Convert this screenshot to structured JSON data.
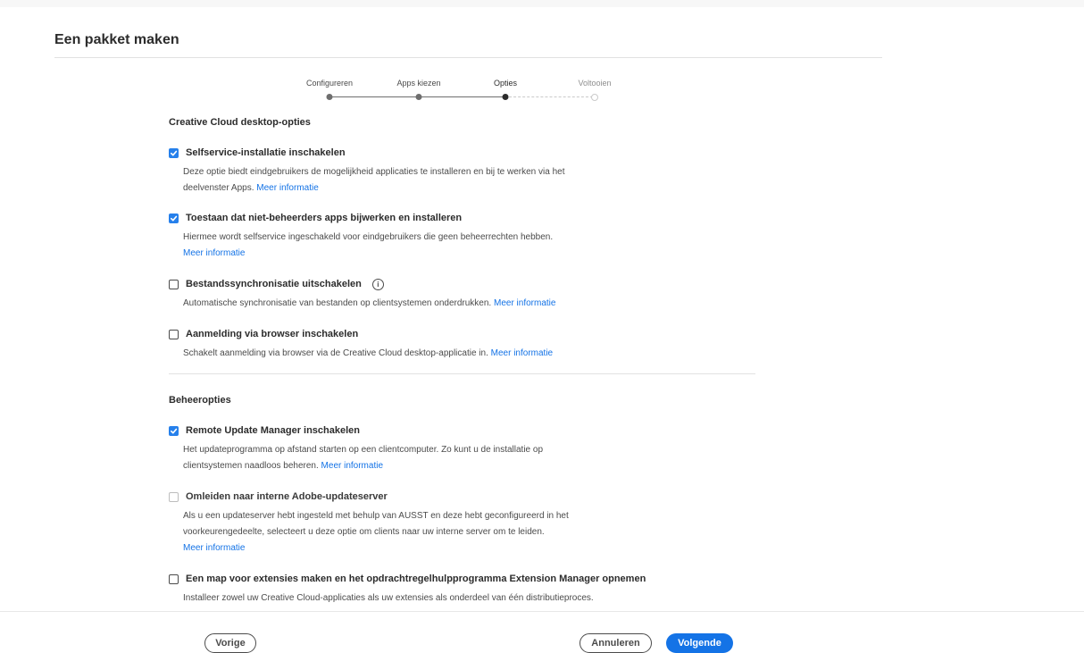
{
  "dialog": {
    "title": "Een pakket maken"
  },
  "stepper": {
    "steps": [
      {
        "label": "Configureren",
        "state": "done"
      },
      {
        "label": "Apps kiezen",
        "state": "done"
      },
      {
        "label": "Opties",
        "state": "active"
      },
      {
        "label": "Voltooien",
        "state": "future"
      }
    ]
  },
  "sections": {
    "desktop": {
      "title": "Creative Cloud desktop-opties"
    },
    "admin": {
      "title": "Beheeropties"
    }
  },
  "options": {
    "self_service": {
      "checked": true,
      "label": "Selfservice-installatie inschakelen",
      "desc_line1": "Deze optie biedt eindgebruikers de mogelijkheid applicaties te installeren en bij te werken via het",
      "desc_line2": "deelvenster Apps.",
      "link": "Meer informatie"
    },
    "non_admin": {
      "checked": true,
      "label": "Toestaan dat niet-beheerders apps bijwerken en installeren",
      "desc_line1": "Hiermee wordt selfservice ingeschakeld voor eindgebruikers die geen beheerrechten hebben.",
      "link": "Meer informatie"
    },
    "file_sync": {
      "checked": false,
      "label": "Bestandssynchronisatie uitschakelen",
      "desc_line1": "Automatische synchronisatie van bestanden op clientsystemen onderdrukken.",
      "link": "Meer informatie"
    },
    "browser_login": {
      "checked": false,
      "label": "Aanmelding via browser inschakelen",
      "desc_line1": "Schakelt aanmelding via browser via de Creative Cloud desktop-applicatie in.",
      "link": "Meer informatie"
    },
    "rum": {
      "checked": true,
      "label": "Remote Update Manager inschakelen",
      "desc_line1": "Het updateprogramma op afstand starten op een clientcomputer. Zo kunt u de installatie op",
      "desc_line2": "clientsystemen naadloos beheren.",
      "link": "Meer informatie"
    },
    "internal_server": {
      "checked": false,
      "disabled": true,
      "label": "Omleiden naar interne Adobe-updateserver",
      "desc_line1": "Als u een updateserver hebt ingesteld met behulp van AUSST en deze hebt geconfigureerd in het",
      "desc_line2": "voorkeurengedeelte, selecteert u deze optie om clients naar uw interne server om te leiden.",
      "link": "Meer informatie"
    },
    "extensions": {
      "checked": false,
      "label": "Een map voor extensies maken en het opdrachtregelhulpprogramma Extension Manager opnemen",
      "desc_line1": "Installeer zowel uw Creative Cloud-applicaties als uw extensies als onderdeel van één distributieproces."
    }
  },
  "footer": {
    "back_label": "Vorige",
    "cancel_label": "Annuleren",
    "next_label": "Volgende"
  },
  "icons": {
    "checkbox_checked": "checkmark-icon",
    "info": "info-icon"
  },
  "colors": {
    "accent": "#1473e6",
    "checkbox": "#2680eb"
  }
}
